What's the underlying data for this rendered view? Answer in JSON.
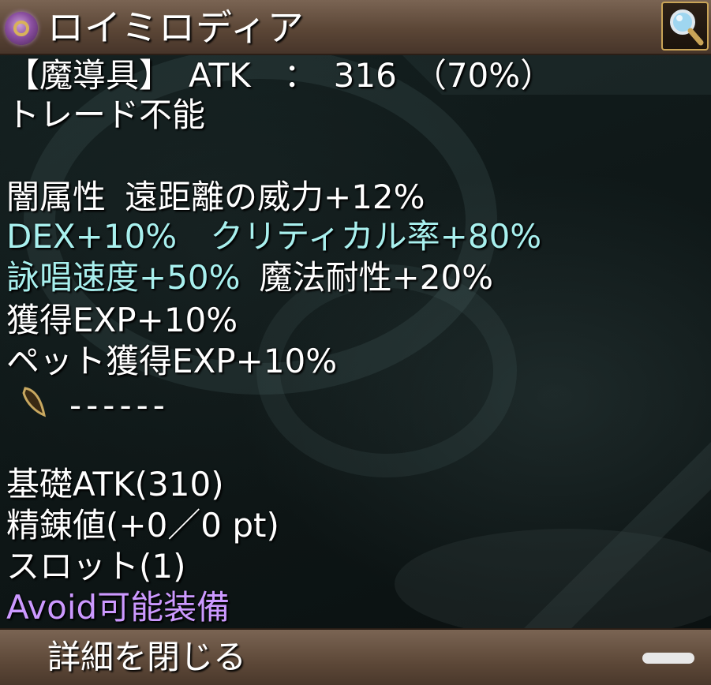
{
  "title": {
    "name": "ロイミロディア"
  },
  "icons": {
    "item": "orb-icon",
    "search": "magnifier-icon",
    "card": "card-slot-icon"
  },
  "stats": {
    "type_line": "【魔導具】　ATK　：　316　（70%）",
    "trade": "トレード不能",
    "line1": [
      "闇属性",
      "遠距離の威力+12%"
    ],
    "line2": "DEX+10%　クリティカル率+80%",
    "line3_cyan": "詠唱速度+50%",
    "line3_white": "魔法耐性+20%",
    "line4": "獲得EXP+10%",
    "line5": "ペット獲得EXP+10%",
    "slot_dash": "------",
    "base_atk": "基礎ATK(310)",
    "refine": "精錬値(+0／0 pt)",
    "slots": "スロット(1)",
    "avoid": "Avoid可能装備"
  },
  "footer": {
    "close_label": "詳細を閉じる"
  },
  "colors": {
    "white": "#ffffff",
    "cyan": "#a8f0ee",
    "purple": "#cc99ff",
    "bar": "#5b4636",
    "gold": "#c9a457"
  }
}
